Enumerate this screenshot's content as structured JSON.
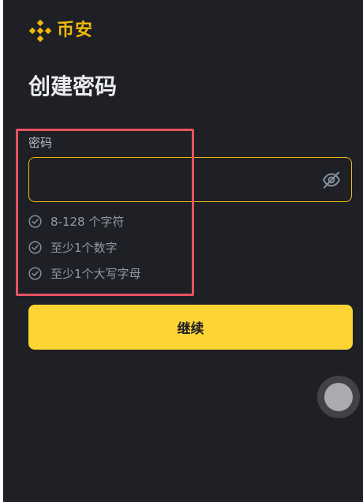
{
  "brand": {
    "logo_icon": "binance-logo-icon",
    "name": "币安",
    "color": "#f0b90b"
  },
  "page": {
    "title": "创建密码"
  },
  "password": {
    "label": "密码",
    "value": "",
    "placeholder": "",
    "visibility_icon": "eye-off-icon",
    "border_color": "#f0b90b"
  },
  "requirements": {
    "check_icon": "check-circle-icon",
    "items": [
      {
        "text": "8-128 个字符"
      },
      {
        "text": "至少1个数字"
      },
      {
        "text": "至少1个大写字母"
      }
    ]
  },
  "actions": {
    "continue_label": "继续",
    "continue_color": "#fcd535"
  },
  "annotation": {
    "highlight_color": "#e8525f"
  },
  "floating_button": {
    "icon": "assistive-touch-icon"
  }
}
